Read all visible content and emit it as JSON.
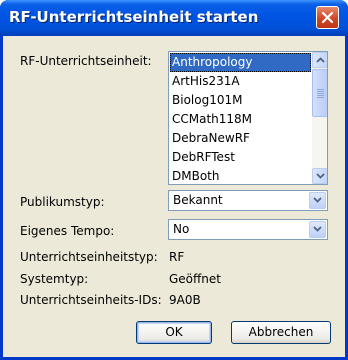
{
  "window": {
    "title": "RF-Unterrichtseinheit starten",
    "close_icon": "close-icon"
  },
  "unit_field": {
    "label": "RF-Unterrichtseinheit:",
    "items": [
      "Anthropology",
      "ArtHis231A",
      "Biolog101M",
      "CCMath118M",
      "DebraNewRF",
      "DebRFTest",
      "DMBoth"
    ],
    "selected": "Anthropology"
  },
  "audience": {
    "label": "Publikumstyp:",
    "value": "Bekannt"
  },
  "pace": {
    "label": "Eigenes Tempo:",
    "value": "No"
  },
  "info": {
    "unit_type_label": "Unterrichtseinheitstyp:",
    "unit_type_value": "RF",
    "system_type_label": "Systemtyp:",
    "system_type_value": "Geöffnet",
    "unit_ids_label": "Unterrichtseinheits-IDs:",
    "unit_ids_value": "9A0B"
  },
  "buttons": {
    "ok": "OK",
    "cancel": "Abbrechen"
  },
  "colors": {
    "title_bar": "#0054e3",
    "selection": "#316ac5",
    "dialog_background": "#ece9d8",
    "close_button": "#d0452a"
  }
}
